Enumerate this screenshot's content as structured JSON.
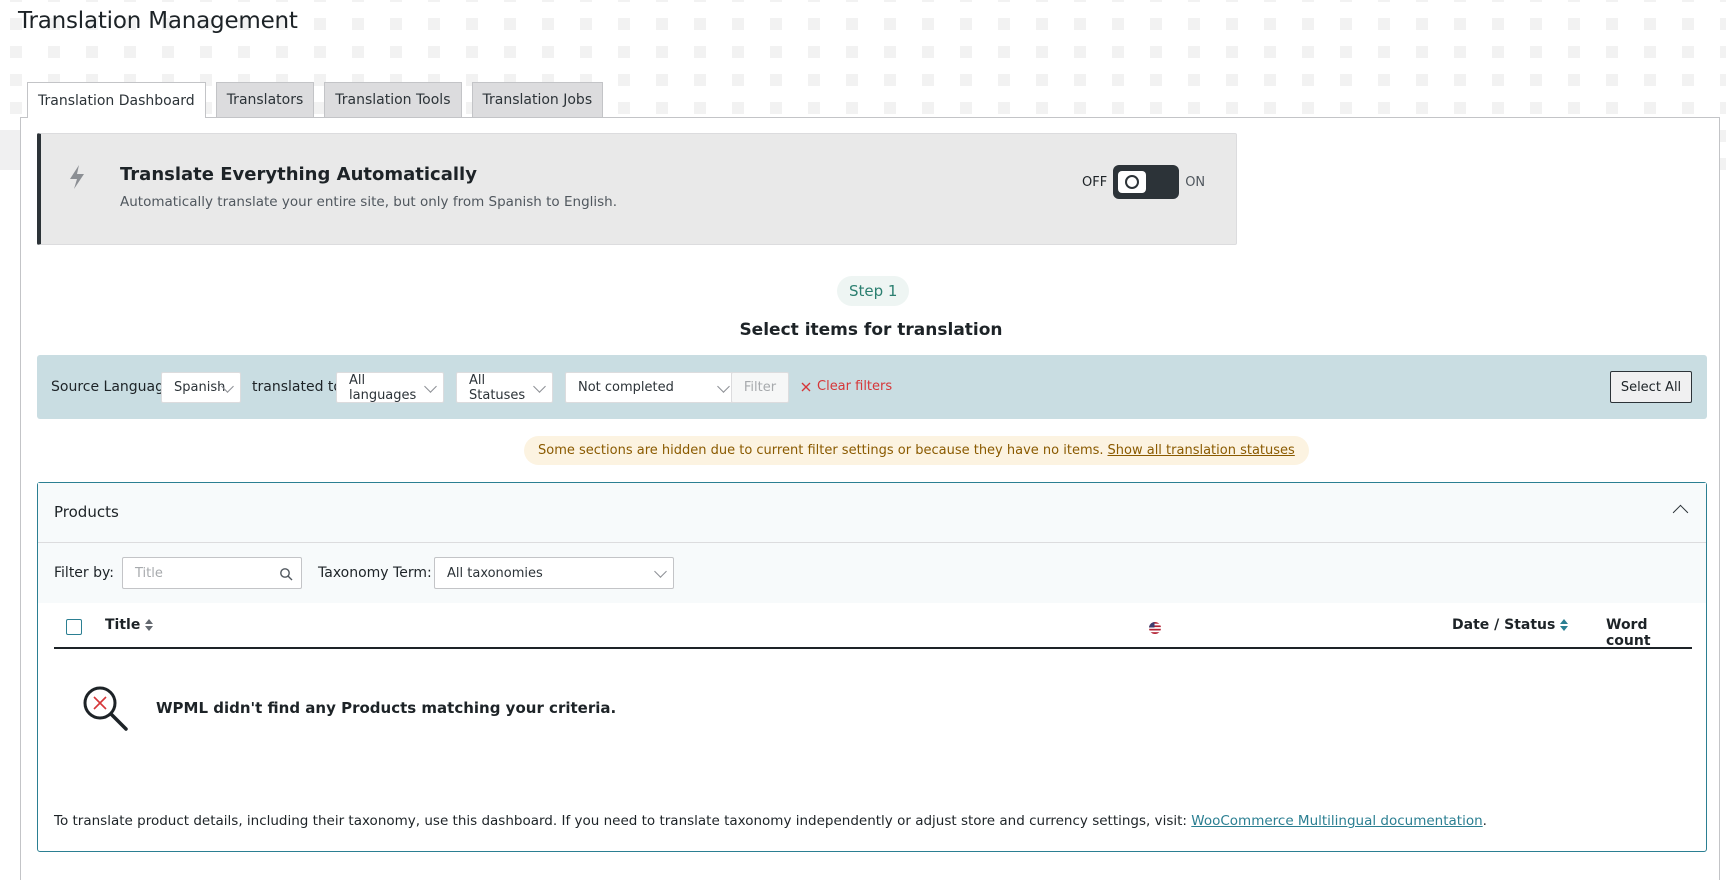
{
  "page": {
    "title": "Translation Management"
  },
  "tabs": [
    {
      "label": "Translation Dashboard",
      "active": true
    },
    {
      "label": "Translators",
      "active": false
    },
    {
      "label": "Translation Tools",
      "active": false
    },
    {
      "label": "Translation Jobs",
      "active": false
    }
  ],
  "auto_translate": {
    "icon": "bolt-icon",
    "title": "Translate Everything Automatically",
    "description": "Automatically translate your entire site, but only from Spanish to English.",
    "toggle_off_label": "OFF",
    "toggle_on_label": "ON",
    "enabled": false
  },
  "step": {
    "label": "Step 1",
    "heading": "Select items for translation"
  },
  "filters": {
    "source_language_label": "Source Language:",
    "source_language_value": "Spanish",
    "translated_to_label": "translated to:",
    "translated_to_value": "All languages",
    "status_value": "All Statuses",
    "completion_value": "Not completed",
    "filter_button": "Filter",
    "clear_filters": "Clear filters",
    "select_all": "Select All"
  },
  "notice": {
    "text": "Some sections are hidden due to current filter settings or because they have no items.",
    "link": "Show all translation statuses"
  },
  "products": {
    "title": "Products",
    "filter_by_label": "Filter by:",
    "title_placeholder": "Title",
    "taxonomy_label": "Taxonomy Term:",
    "taxonomy_value": "All taxonomies",
    "columns": {
      "title": "Title",
      "language_flag": "us-flag-icon",
      "date_status": "Date / Status",
      "word_count": "Word count"
    },
    "empty_message": "WPML didn't find any Products matching your criteria.",
    "footer_text": "To translate product details, including their taxonomy, use this dashboard. If you need to translate taxonomy independently or adjust store and currency settings, visit:",
    "footer_link": "WooCommerce Multilingual documentation",
    "footer_end": "."
  },
  "colors": {
    "accent_teal": "#2b7f92",
    "filter_bar_bg": "#c9dde2",
    "notice_bg": "#fcf3e1",
    "danger": "#d63638"
  }
}
